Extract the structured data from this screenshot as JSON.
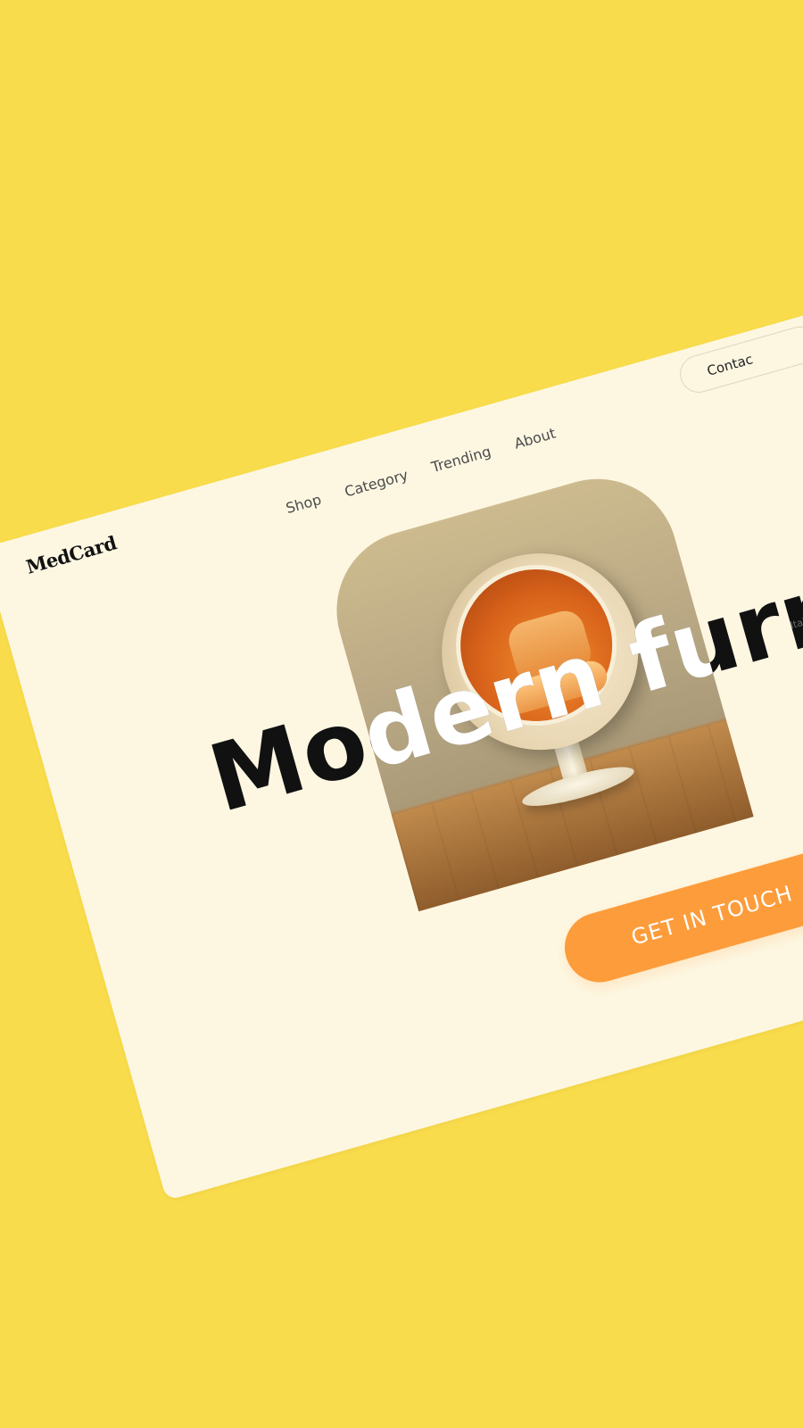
{
  "brand": {
    "logo": "MedCard"
  },
  "nav": {
    "items": [
      {
        "label": "Shop"
      },
      {
        "label": "Category"
      },
      {
        "label": "Trending"
      },
      {
        "label": "About"
      }
    ],
    "contact_label": "Contac"
  },
  "hero": {
    "headline": "Modern furnitu",
    "description": "Italian C bedroo as wel",
    "cta_label": "GET IN TOUCH"
  },
  "colors": {
    "background": "#f9dc4b",
    "card": "#fdf7e2",
    "accent": "#fd9c3b"
  }
}
